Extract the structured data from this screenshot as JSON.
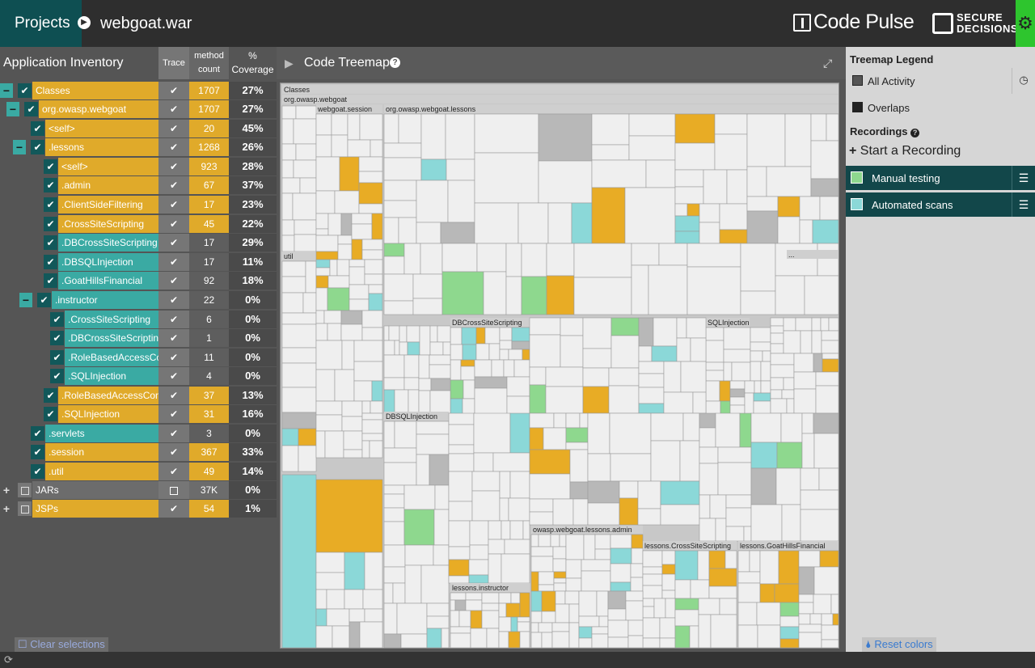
{
  "header": {
    "projects_label": "Projects",
    "separator_icon": "chevron-right-icon",
    "project_name": "webgoat.war",
    "logo_text": "Code Pulse",
    "partner_logo_line1": "SECURE",
    "partner_logo_line2": "DECISIONS",
    "settings_icon": "gear-icon",
    "accent_color": "#2ec52e"
  },
  "inventory": {
    "title": "Application Inventory",
    "columns": {
      "trace": "Trace",
      "method_count_line1": "method",
      "method_count_line2": "count",
      "coverage_line1": "%",
      "coverage_line2": "Coverage"
    },
    "rows": [
      {
        "name": "Classes",
        "toggle": "−",
        "checked": true,
        "traced": true,
        "count": "1707",
        "coverage": "27%",
        "color": "#e0aa2a"
      },
      {
        "name": "org.owasp.webgoat",
        "toggle": "−",
        "checked": true,
        "traced": true,
        "count": "1707",
        "coverage": "27%",
        "color": "#e0aa2a"
      },
      {
        "name": "<self>",
        "toggle": "",
        "checked": true,
        "traced": true,
        "count": "20",
        "coverage": "45%",
        "color": "#e0aa2a"
      },
      {
        "name": ".lessons",
        "toggle": "−",
        "checked": true,
        "traced": true,
        "count": "1268",
        "coverage": "26%",
        "color": "#e0aa2a"
      },
      {
        "name": "<self>",
        "toggle": "",
        "checked": true,
        "traced": true,
        "count": "923",
        "coverage": "28%",
        "color": "#e0aa2a"
      },
      {
        "name": ".admin",
        "toggle": "",
        "checked": true,
        "traced": true,
        "count": "67",
        "coverage": "37%",
        "color": "#e0aa2a"
      },
      {
        "name": ".ClientSideFiltering",
        "toggle": "",
        "checked": true,
        "traced": true,
        "count": "17",
        "coverage": "23%",
        "color": "#e0aa2a"
      },
      {
        "name": ".CrossSiteScripting",
        "toggle": "",
        "checked": true,
        "traced": true,
        "count": "45",
        "coverage": "22%",
        "color": "#e0aa2a"
      },
      {
        "name": ".DBCrossSiteScripting",
        "toggle": "",
        "checked": true,
        "traced": true,
        "count": "17",
        "coverage": "29%",
        "color": "#3aaaa3"
      },
      {
        "name": ".DBSQLInjection",
        "toggle": "",
        "checked": true,
        "traced": true,
        "count": "17",
        "coverage": "11%",
        "color": "#3aaaa3"
      },
      {
        "name": ".GoatHillsFinancial",
        "toggle": "",
        "checked": true,
        "traced": true,
        "count": "92",
        "coverage": "18%",
        "color": "#3aaaa3"
      },
      {
        "name": ".instructor",
        "toggle": "−",
        "checked": true,
        "traced": true,
        "count": "22",
        "coverage": "0%",
        "color": "#3aaaa3"
      },
      {
        "name": ".CrossSiteScripting",
        "toggle": "",
        "checked": true,
        "traced": true,
        "count": "6",
        "coverage": "0%",
        "color": "#3aaaa3"
      },
      {
        "name": ".DBCrossSiteScripting",
        "toggle": "",
        "checked": true,
        "traced": true,
        "count": "1",
        "coverage": "0%",
        "color": "#3aaaa3"
      },
      {
        "name": ".RoleBasedAccessCo...",
        "toggle": "",
        "checked": true,
        "traced": true,
        "count": "11",
        "coverage": "0%",
        "color": "#3aaaa3"
      },
      {
        "name": ".SQLInjection",
        "toggle": "",
        "checked": true,
        "traced": true,
        "count": "4",
        "coverage": "0%",
        "color": "#3aaaa3"
      },
      {
        "name": ".RoleBasedAccessCont...",
        "toggle": "",
        "checked": true,
        "traced": true,
        "count": "37",
        "coverage": "13%",
        "color": "#e0aa2a"
      },
      {
        "name": ".SQLInjection",
        "toggle": "",
        "checked": true,
        "traced": true,
        "count": "31",
        "coverage": "16%",
        "color": "#e0aa2a"
      },
      {
        "name": ".servlets",
        "toggle": "",
        "checked": true,
        "traced": true,
        "count": "3",
        "coverage": "0%",
        "color": "#3aaaa3"
      },
      {
        "name": ".session",
        "toggle": "",
        "checked": true,
        "traced": true,
        "count": "367",
        "coverage": "33%",
        "color": "#e0aa2a"
      },
      {
        "name": ".util",
        "toggle": "",
        "checked": true,
        "traced": true,
        "count": "49",
        "coverage": "14%",
        "color": "#e0aa2a"
      },
      {
        "name": "JARs",
        "toggle": "+",
        "checked": false,
        "traced": false,
        "count": "37K",
        "coverage": "0%",
        "color": "#6c6c6c"
      },
      {
        "name": "JSPs",
        "toggle": "+",
        "checked": false,
        "traced": true,
        "count": "54",
        "coverage": "1%",
        "color": "#e0aa2a"
      }
    ],
    "clear_label": "Clear selections"
  },
  "treemap": {
    "title": "Code Treemap",
    "labels": [
      "Classes",
      "org.owasp.webgoat",
      "webgoat.session",
      "org.owasp.webgoat.lessons",
      "util",
      "DBCrossSiteScripting",
      "SQLInjection",
      "DBSQLInjection",
      "owasp.webgoat.lessons.admin",
      "lessons.CrossSiteScripting",
      "lessons.GoatHillsFinancial",
      "lessons.instructor",
      "..."
    ],
    "colors": {
      "base": "#efefef",
      "orange": "#e8ac25",
      "cyan": "#8bd8d8",
      "green": "#8ed88e",
      "gray": "#b8b8b8"
    }
  },
  "legend": {
    "title": "Treemap Legend",
    "items": [
      {
        "label": "All Activity",
        "color": "#555555"
      },
      {
        "label": "Overlaps",
        "color": "#222222"
      }
    ],
    "recordings_title": "Recordings",
    "start_label": "Start a Recording",
    "recordings": [
      {
        "label": "Manual testing",
        "color": "#8ed88e"
      },
      {
        "label": "Automated scans",
        "color": "#8bd8d8"
      }
    ],
    "reset_label": "Reset colors"
  }
}
